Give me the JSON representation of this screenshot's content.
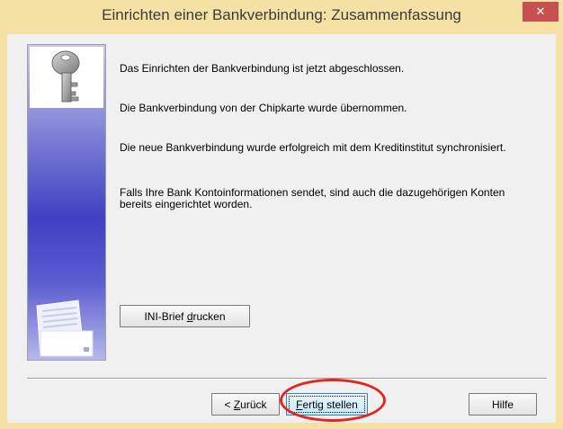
{
  "window": {
    "title": "Einrichten einer Bankverbindung: Zusammenfassung",
    "close_glyph": "✕"
  },
  "messages": [
    "Das Einrichten der Bankverbindung ist jetzt abgeschlossen.",
    "Die Bankverbindung von der Chipkarte wurde übernommen.",
    "Die neue Bankverbindung wurde erfolgreich mit dem Kreditinstitut synchronisiert.",
    "Falls Ihre Bank Kontoinformationen sendet, sind auch die dazugehörigen Konten bereits eingerichtet worden."
  ],
  "buttons": {
    "ini_brief": {
      "pre": "INI-Brief ",
      "accel": "d",
      "post": "rucken"
    },
    "back": {
      "pre": "< ",
      "accel": "Z",
      "post": "urück"
    },
    "finish": {
      "pre": "",
      "accel": "F",
      "post": "ertig stellen"
    },
    "help": {
      "label": "Hilfe"
    }
  },
  "icons": {
    "key": "key-icon",
    "document": "letter-document-icon"
  },
  "colors": {
    "title_bar": "#f6e1a4",
    "close_button": "#c75050",
    "dialog_background": "#f0f0f0",
    "side_panel_blue": "#3f40c4",
    "highlight_ring": "#e2251d"
  }
}
